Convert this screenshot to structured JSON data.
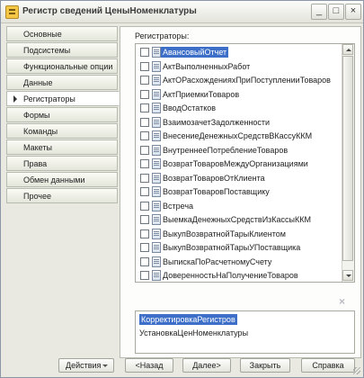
{
  "window": {
    "title": "Регистр сведений ЦеныНоменклатуры",
    "controls": {
      "minimize": "_",
      "maximize": "□",
      "close": "×"
    }
  },
  "nav_tabs": [
    {
      "label": "Основные"
    },
    {
      "label": "Подсистемы"
    },
    {
      "label": "Функциональные опции"
    },
    {
      "label": "Данные"
    },
    {
      "label": "Регистраторы",
      "active": true
    },
    {
      "label": "Формы"
    },
    {
      "label": "Команды"
    },
    {
      "label": "Макеты"
    },
    {
      "label": "Права"
    },
    {
      "label": "Обмен данными"
    },
    {
      "label": "Прочее"
    }
  ],
  "registrators": {
    "label": "Регистраторы:",
    "items": [
      {
        "label": "АвансовыйОтчет",
        "checked": false,
        "selected": true
      },
      {
        "label": "АктВыполненныхРабот",
        "checked": false
      },
      {
        "label": "АктОРасхожденияхПриПоступленииТоваров",
        "checked": false
      },
      {
        "label": "АктПриемкиТоваров",
        "checked": false
      },
      {
        "label": "ВводОстатков",
        "checked": false
      },
      {
        "label": "ВзаимозачетЗадолженности",
        "checked": false
      },
      {
        "label": "ВнесениеДенежныхСредствВКассуККМ",
        "checked": false
      },
      {
        "label": "ВнутреннееПотреблениеТоваров",
        "checked": false
      },
      {
        "label": "ВозвратТоваровМеждуОрганизациями",
        "checked": false
      },
      {
        "label": "ВозвратТоваровОтКлиента",
        "checked": false
      },
      {
        "label": "ВозвратТоваровПоставщику",
        "checked": false
      },
      {
        "label": "Встреча",
        "checked": false
      },
      {
        "label": "ВыемкаДенежныхСредствИзКассыККМ",
        "checked": false
      },
      {
        "label": "ВыкупВозвратнойТарыКлиентом",
        "checked": false
      },
      {
        "label": "ВыкупВозвратнойТарыУПоставщика",
        "checked": false
      },
      {
        "label": "ВыпискаПоРасчетномуСчету",
        "checked": false
      },
      {
        "label": "ДоверенностьНаПолучениеТоваров",
        "checked": false
      }
    ]
  },
  "selected_registrators": {
    "clear_icon": "×",
    "items": [
      {
        "label": "КорректировкаРегистров",
        "selected": true
      },
      {
        "label": "УстановкаЦенНоменклатуры",
        "selected": false
      }
    ]
  },
  "buttons": {
    "actions": "Действия",
    "back": "<Назад",
    "next": "Далее>",
    "close": "Закрыть",
    "help": "Справка"
  }
}
